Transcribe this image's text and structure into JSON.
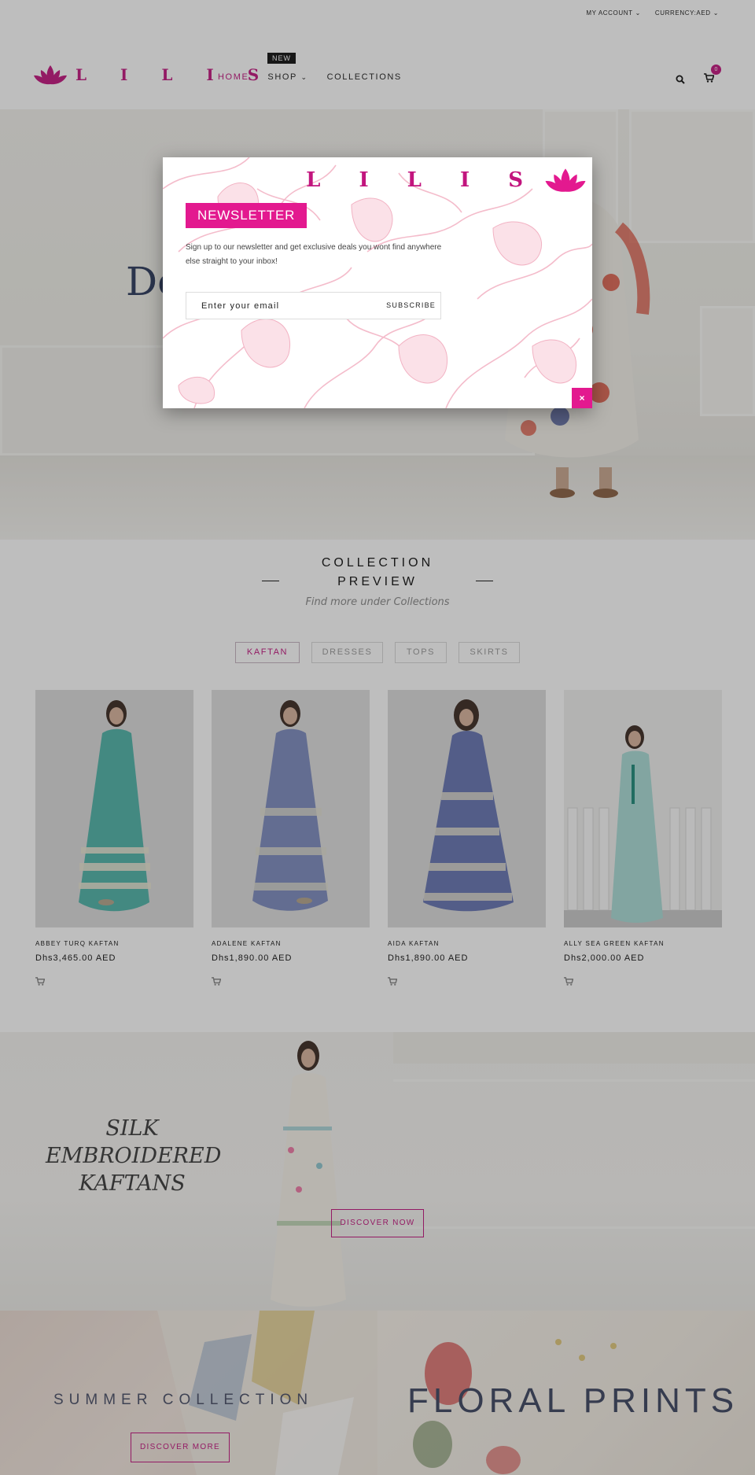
{
  "topbar": {
    "my_account": "MY ACCOUNT",
    "currency": "CURRENCY:AED"
  },
  "brand": {
    "name": "L I L I S",
    "accent": "#c2157e",
    "popup_accent": "#e3198f"
  },
  "nav": {
    "home": "HOME",
    "shop": "SHOP",
    "shop_badge": "NEW",
    "collections": "COLLECTIONS"
  },
  "header_icons": {
    "search": "search-icon",
    "cart": "cart-icon",
    "cart_count": "0"
  },
  "hero": {
    "heading_visible": "De"
  },
  "collection": {
    "title_line1": "COLLECTION",
    "title_line2": "PREVIEW",
    "subtitle": "Find more under Collections",
    "tabs": [
      {
        "label": "KAFTAN",
        "active": true
      },
      {
        "label": "DRESSES",
        "active": false
      },
      {
        "label": "TOPS",
        "active": false
      },
      {
        "label": "SKIRTS",
        "active": false
      }
    ],
    "products": [
      {
        "name": "ABBEY TURQ KAFTAN",
        "price": "Dhs3,465.00 AED",
        "dress_color": "#4fb3a8"
      },
      {
        "name": "ADALENE KAFTAN",
        "price": "Dhs1,890.00 AED",
        "dress_color": "#7d8bbf"
      },
      {
        "name": "AIDA KAFTAN",
        "price": "Dhs1,890.00 AED",
        "dress_color": "#6675b2"
      },
      {
        "name": "ALLY SEA GREEN KAFTAN",
        "price": "Dhs2,000.00 AED",
        "dress_color": "#a9dbd6"
      }
    ]
  },
  "silk": {
    "line1": "SILK",
    "line2": "EMBROIDERED",
    "line3": "KAFTANS",
    "button": "DISCOVER NOW"
  },
  "banners": {
    "summer": "SUMMER COLLECTION",
    "summer_button": "DISCOVER MORE",
    "floral": "FLORAL PRINTS"
  },
  "popup": {
    "title": "NEWSLETTER",
    "description": "Sign up to our newsletter and get exclusive deals you wont find anywhere else straight to your inbox!",
    "placeholder": "Enter your email",
    "subscribe": "SUBSCRIBE",
    "close": "×"
  }
}
